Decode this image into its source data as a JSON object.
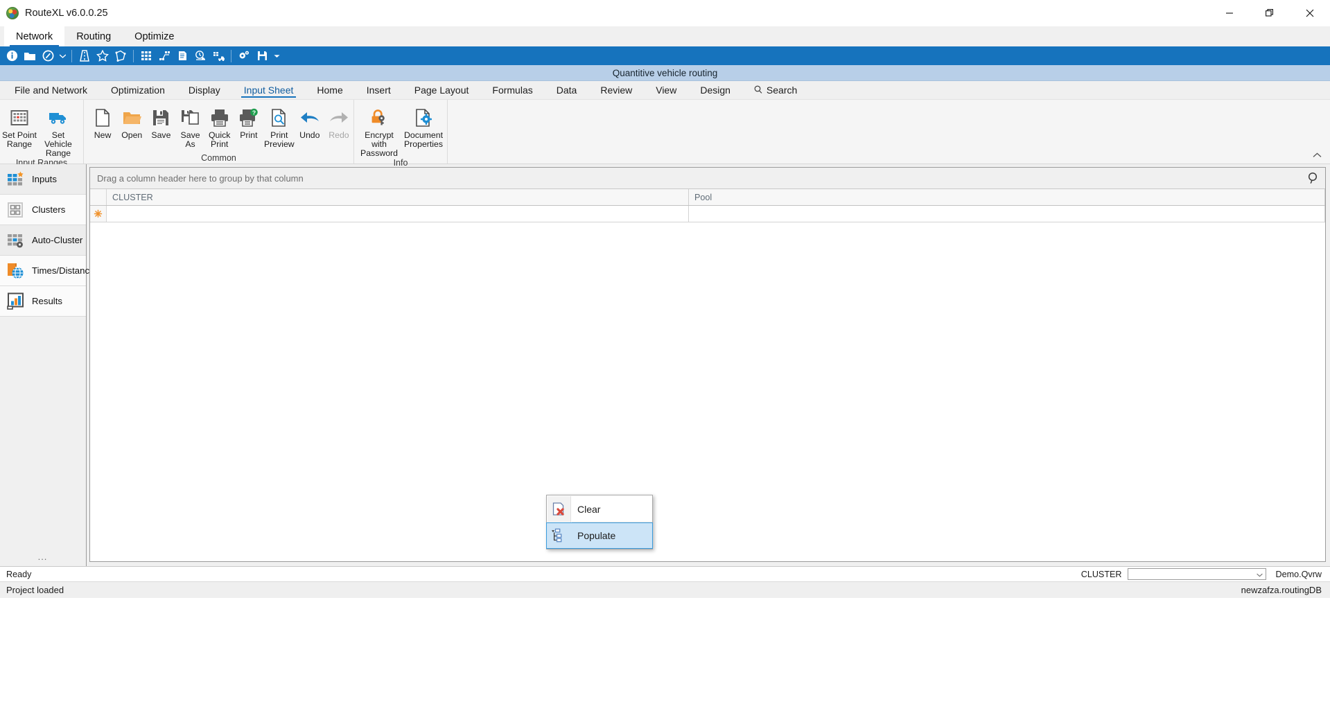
{
  "window": {
    "title": "RouteXL v6.0.0.25",
    "app_icon": "routexl-logo-icon",
    "controls": {
      "minimize": "minimize-icon",
      "restore": "restore-icon",
      "close": "close-icon"
    }
  },
  "menubar": {
    "items": [
      {
        "label": "Network",
        "active": true
      },
      {
        "label": "Routing",
        "active": false
      },
      {
        "label": "Optimize",
        "active": false
      }
    ]
  },
  "toolbar": {
    "buttons": [
      {
        "name": "info-icon"
      },
      {
        "name": "folder-icon"
      },
      {
        "name": "compass-icon"
      },
      {
        "name": "toolbar-caret-icon"
      },
      {
        "name": "road-icon"
      },
      {
        "name": "star-icon"
      },
      {
        "name": "polygon-icon"
      },
      {
        "name": "matrix-grid-icon"
      },
      {
        "name": "network-nodes-icon"
      },
      {
        "name": "document-icon"
      },
      {
        "name": "truck-clock-icon"
      },
      {
        "name": "truck-fleet-icon"
      },
      {
        "name": "gears-icon"
      },
      {
        "name": "save-disk-icon"
      },
      {
        "name": "overflow-caret-icon"
      }
    ]
  },
  "document": {
    "title": "Quantitive vehicle routing"
  },
  "ribbon_tabs": {
    "items": [
      {
        "label": "File and Network",
        "active": false
      },
      {
        "label": "Optimization",
        "active": false
      },
      {
        "label": "Display",
        "active": false
      },
      {
        "label": "Input Sheet",
        "active": true
      },
      {
        "label": "Home",
        "active": false
      },
      {
        "label": "Insert",
        "active": false
      },
      {
        "label": "Page Layout",
        "active": false
      },
      {
        "label": "Formulas",
        "active": false
      },
      {
        "label": "Data",
        "active": false
      },
      {
        "label": "Review",
        "active": false
      },
      {
        "label": "View",
        "active": false
      },
      {
        "label": "Design",
        "active": false
      }
    ],
    "search_label": "Search",
    "search_icon": "search-icon",
    "collapse_icon": "chevron-up-icon"
  },
  "ribbon": {
    "groups": [
      {
        "label": "Input Ranges",
        "buttons": [
          {
            "label": "Set Point Range",
            "line1": "Set Point",
            "line2": "Range",
            "icon": "point-grid-icon",
            "disabled": false
          },
          {
            "label": "Set Vehicle Range",
            "line1": "Set Vehicle",
            "line2": "Range",
            "icon": "truck-icon",
            "disabled": false
          }
        ]
      },
      {
        "label": "Common",
        "buttons": [
          {
            "label": "New",
            "line1": "New",
            "line2": "",
            "icon": "new-file-icon",
            "disabled": false
          },
          {
            "label": "Open",
            "line1": "Open",
            "line2": "",
            "icon": "open-folder-icon",
            "disabled": false
          },
          {
            "label": "Save",
            "line1": "Save",
            "line2": "",
            "icon": "save-icon",
            "disabled": false
          },
          {
            "label": "Save As",
            "line1": "Save As",
            "line2": "",
            "icon": "save-as-icon",
            "disabled": false
          },
          {
            "label": "Quick Print",
            "line1": "Quick",
            "line2": "Print",
            "icon": "quick-print-icon",
            "disabled": false
          },
          {
            "label": "Print",
            "line1": "Print",
            "line2": "",
            "icon": "print-icon",
            "disabled": false
          },
          {
            "label": "Print Preview",
            "line1": "Print",
            "line2": "Preview",
            "icon": "print-preview-icon",
            "disabled": false
          },
          {
            "label": "Undo",
            "line1": "Undo",
            "line2": "",
            "icon": "undo-icon",
            "disabled": false
          },
          {
            "label": "Redo",
            "line1": "Redo",
            "line2": "",
            "icon": "redo-icon",
            "disabled": true
          }
        ]
      },
      {
        "label": "Info",
        "buttons": [
          {
            "label": "Encrypt with Password",
            "line1": "Encrypt with",
            "line2": "Password",
            "icon": "lock-key-icon",
            "disabled": false
          },
          {
            "label": "Document Properties",
            "line1": "Document",
            "line2": "Properties",
            "icon": "document-properties-icon",
            "disabled": false
          }
        ]
      }
    ]
  },
  "sidebar": {
    "items": [
      {
        "label": "Inputs",
        "icon": "inputs-grid-icon",
        "active": true
      },
      {
        "label": "Clusters",
        "icon": "clusters-grid-icon",
        "active": false
      },
      {
        "label": "Auto-Cluster",
        "icon": "auto-cluster-icon",
        "active": false
      },
      {
        "label": "Times/Distances",
        "icon": "times-distances-globe-icon",
        "active": false
      },
      {
        "label": "Results",
        "icon": "results-chart-icon",
        "active": false
      }
    ],
    "ellipsis": "..."
  },
  "grid": {
    "group_hint": "Drag a column header here to group by that column",
    "find_icon": "search-icon",
    "columns": [
      "CLUSTER",
      "Pool"
    ],
    "rows": [
      {
        "indicator": "new-row-star-icon",
        "CLUSTER": "",
        "Pool": ""
      }
    ]
  },
  "context_menu": {
    "items": [
      {
        "label": "Clear",
        "icon": "clear-page-icon",
        "selected": false
      },
      {
        "label": "Populate",
        "icon": "populate-tree-icon",
        "selected": true
      }
    ]
  },
  "status_bar": {
    "ready_text": "Ready",
    "cluster_label": "CLUSTER",
    "cluster_value": "",
    "cluster_dropdown_icon": "chevron-down-icon",
    "file_name": "Demo.Qvrw"
  },
  "footer_bar": {
    "message": "Project loaded",
    "database": "newzafza.routingDB"
  },
  "colors": {
    "accent_blue": "#1673bd",
    "doc_title_bg": "#b8cfe8",
    "selection_blue": "#cce4f7",
    "selection_border": "#3a9bdc",
    "orange": "#ef8b28",
    "sidebar_bg": "#f0f0f0"
  }
}
